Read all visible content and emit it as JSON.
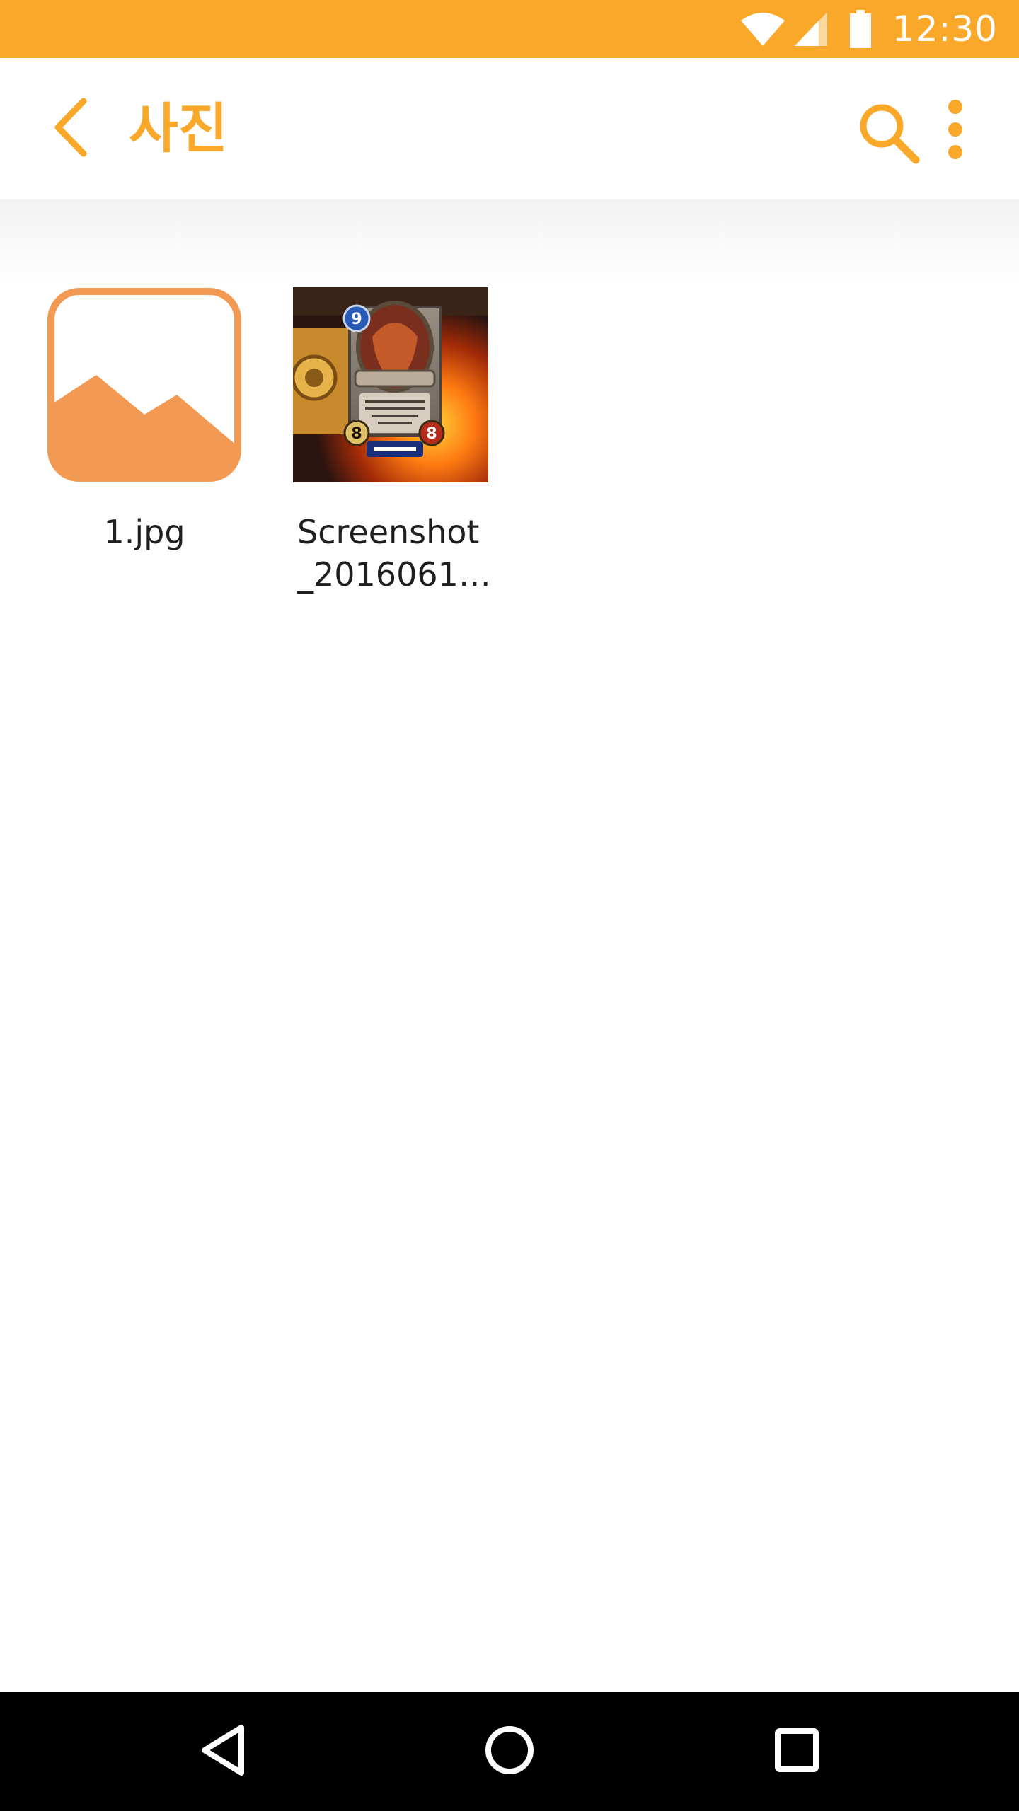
{
  "status_bar": {
    "time": "12:30",
    "background": "#F9A82A",
    "icons": [
      "wifi-icon",
      "signal-icon",
      "battery-icon"
    ]
  },
  "app_bar": {
    "title": "사진",
    "accent": "#F9A82A",
    "icons": [
      "back-arrow-icon",
      "search-icon",
      "more-vert-icon"
    ]
  },
  "files": [
    {
      "name": "1.jpg",
      "thumbnail": "image-placeholder-icon",
      "thumb_color": "#F29A53"
    },
    {
      "name": "Screenshot\n_2016061…",
      "thumbnail": "card-screenshot"
    }
  ],
  "nav_bar": {
    "background": "#000000",
    "icons": [
      "nav-back-icon",
      "nav-home-icon",
      "nav-recent-icon"
    ]
  }
}
